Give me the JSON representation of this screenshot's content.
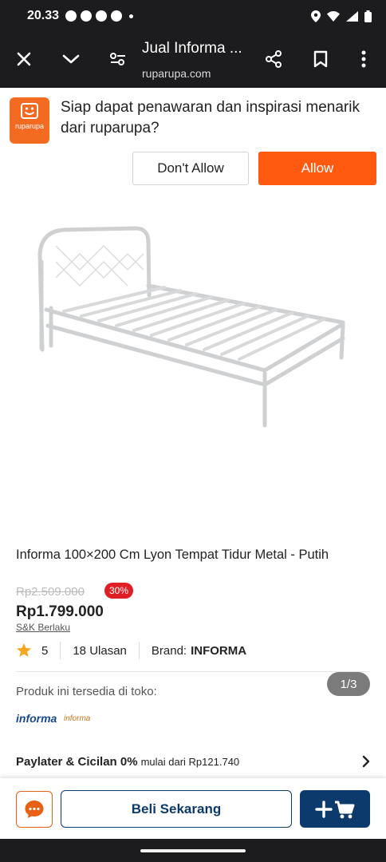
{
  "status_bar": {
    "time": "20.33",
    "notification_icons": [
      "chat-bubble-icon",
      "help-icon",
      "help-icon",
      "help-icon"
    ],
    "system_icons": [
      "location-icon",
      "wifi-icon",
      "signal-icon",
      "battery-icon"
    ]
  },
  "browser_toolbar": {
    "title": "Jual Informa ...",
    "url": "ruparupa.com",
    "icons": [
      "close-icon",
      "chevron-down-icon",
      "page-settings-icon",
      "share-icon",
      "bookmark-icon",
      "more-vert-icon"
    ]
  },
  "notification_prompt": {
    "brand": "ruparupa",
    "message": "Siap dapat penawaran dan inspirasi menarik dari ruparupa?",
    "dont_allow_label": "Don't Allow",
    "allow_label": "Allow",
    "allow_color": "#ff5a0f"
  },
  "gallery": {
    "pager": "1/3"
  },
  "product": {
    "title": "Informa 100×200 Cm Lyon Tempat Tidur Metal - Putih",
    "original_price": "Rp2.509.000",
    "discount": "30%",
    "price": "Rp1.799.000",
    "terms_link": "S&K Berlaku",
    "rating": "5",
    "reviews": "18 Ulasan",
    "brand_label": "Brand:",
    "brand_value": "INFORMA",
    "availability_text": "Produk ini tersedia di toko:",
    "stores": [
      "informa",
      "informa"
    ],
    "paylater_bold": "Paylater & Cicilan 0%",
    "paylater_rest": "mulai dari Rp121.740"
  },
  "bottom_bar": {
    "buy_label": "Beli Sekarang",
    "primary_color": "#0d3a6c",
    "chat_color": "#e86016"
  }
}
